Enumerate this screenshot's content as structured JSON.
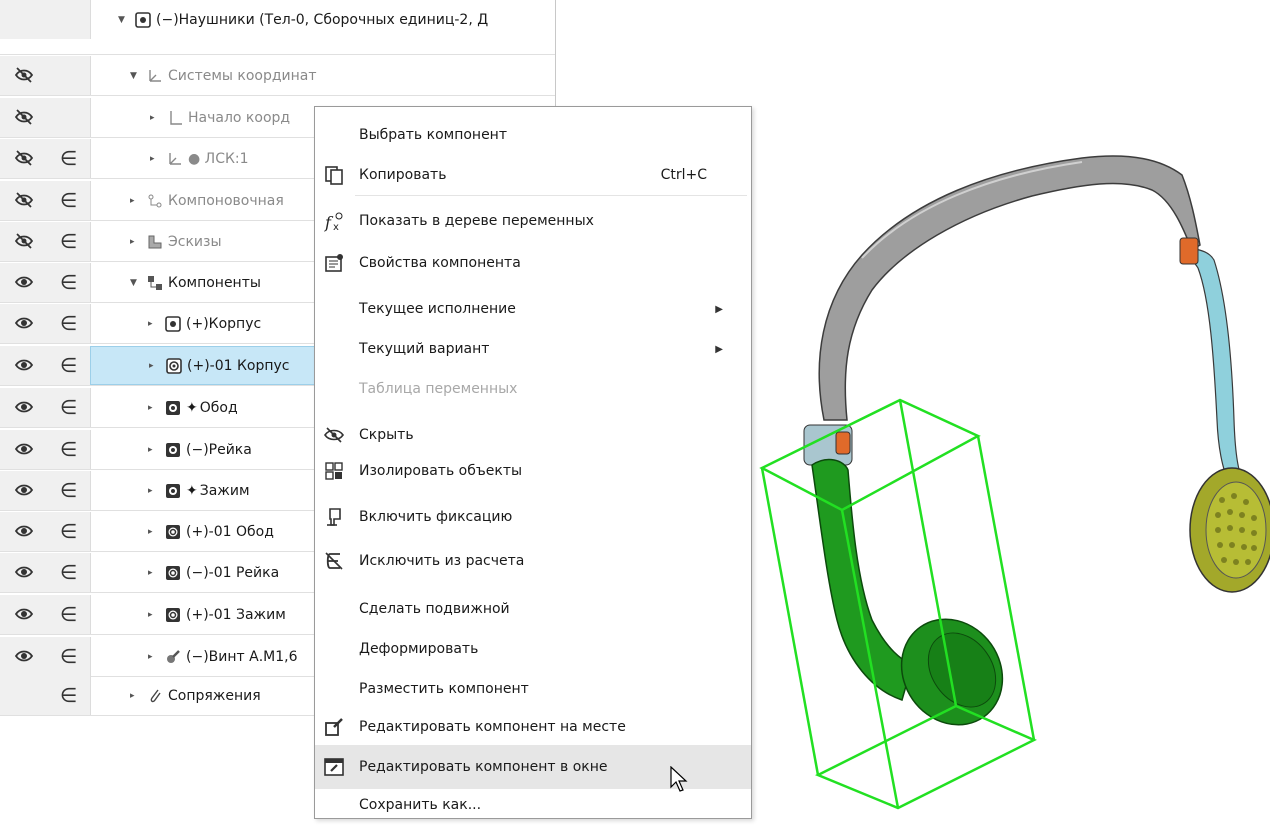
{
  "tree": {
    "rows": [
      {
        "label": "(−)Наушники (Тел-0, Сборочных единиц-2, Д",
        "vis": "",
        "calc": "",
        "arrow": "▼",
        "icon": "assembly-icon"
      },
      {
        "label": "Системы координат",
        "vis": "hidden",
        "calc": "",
        "arrow": "▼",
        "icon": "coordinate-systems-icon"
      },
      {
        "label": "Начало коорд",
        "vis": "hidden",
        "calc": "",
        "arrow": "▸",
        "icon": "origin-icon"
      },
      {
        "label": "● ЛСК:1",
        "vis": "hidden",
        "calc": "∈",
        "arrow": "▸",
        "icon": "lcs-icon"
      },
      {
        "label": "Компоновочная",
        "vis": "hidden",
        "calc": "∈",
        "arrow": "▸",
        "icon": "layout-geometry-icon"
      },
      {
        "label": "Эскизы",
        "vis": "hidden",
        "calc": "∈",
        "arrow": "▸",
        "icon": "sketches-icon"
      },
      {
        "label": "Компоненты",
        "vis": "visible",
        "calc": "∈",
        "arrow": "▼",
        "icon": "components-icon"
      },
      {
        "label": "(+)Корпус",
        "vis": "visible",
        "calc": "∈",
        "arrow": "▸",
        "icon": "subassembly-icon"
      },
      {
        "label": "(+)-01 Корпус",
        "vis": "visible",
        "calc": "∈",
        "arrow": "▸",
        "icon": "subassembly-variant-icon"
      },
      {
        "label": "Обод",
        "vis": "visible",
        "calc": "∈",
        "arrow": "▸",
        "icon": "part-icon",
        "pin": "✦"
      },
      {
        "label": "(−)Рейка",
        "vis": "visible",
        "calc": "∈",
        "arrow": "▸",
        "icon": "part-icon"
      },
      {
        "label": "Зажим",
        "vis": "visible",
        "calc": "∈",
        "arrow": "▸",
        "icon": "part-icon",
        "pin": "✦"
      },
      {
        "label": "(+)-01 Обод",
        "vis": "visible",
        "calc": "∈",
        "arrow": "▸",
        "icon": "part-variant-icon"
      },
      {
        "label": "(−)-01 Рейка",
        "vis": "visible",
        "calc": "∈",
        "arrow": "▸",
        "icon": "part-variant-icon"
      },
      {
        "label": "(+)-01 Зажим",
        "vis": "visible",
        "calc": "∈",
        "arrow": "▸",
        "icon": "part-variant-icon"
      },
      {
        "label": "(−)Винт А.М1,6",
        "vis": "visible",
        "calc": "∈",
        "arrow": "▸",
        "icon": "standard-part-icon"
      },
      {
        "label": "Сопряжения",
        "vis": "",
        "calc": "∈",
        "arrow": "▸",
        "icon": "mates-icon"
      }
    ],
    "selected_index": 8,
    "vis_glyph_visible": "👁",
    "vis_glyph_hidden": "⊘"
  },
  "context_menu": {
    "items": [
      {
        "label": "Выбрать компонент",
        "icon": ""
      },
      {
        "label": "Копировать",
        "shortcut": "Ctrl+C",
        "icon": "copy-icon"
      },
      {
        "label": "Показать в дереве переменных",
        "icon": "fx-icon",
        "sep_before": true
      },
      {
        "label": "Свойства компонента",
        "icon": "properties-icon"
      },
      {
        "label": "Текущее исполнение",
        "submenu": "▶",
        "icon": ""
      },
      {
        "label": "Текущий вариант",
        "submenu": "▶",
        "icon": ""
      },
      {
        "label": "Таблица переменных",
        "disabled": true,
        "icon": ""
      },
      {
        "label": "Скрыть",
        "icon": "hide-icon"
      },
      {
        "label": "Изолировать объекты",
        "icon": "isolate-icon"
      },
      {
        "label": "Включить фиксацию",
        "icon": "fix-icon"
      },
      {
        "label": "Исключить из расчета",
        "icon": "exclude-icon"
      },
      {
        "label": "Сделать подвижной",
        "icon": ""
      },
      {
        "label": "Деформировать",
        "icon": ""
      },
      {
        "label": "Разместить компонент",
        "icon": ""
      },
      {
        "label": "Редактировать компонент на месте",
        "icon": "edit-in-place-icon"
      },
      {
        "label": "Редактировать компонент в окне",
        "icon": "edit-in-window-icon",
        "hover": true
      },
      {
        "label": "Сохранить как...",
        "icon": ""
      }
    ]
  },
  "viewport": {
    "model": "headphones-3d-model",
    "colors": {
      "headband": "#9a9a9a",
      "selected": "#1f9a1f",
      "bbox": "#22e022",
      "arm_right": "#8fd0dc",
      "cup_right": "#a3a82a",
      "joint": "#e06a2a"
    }
  }
}
